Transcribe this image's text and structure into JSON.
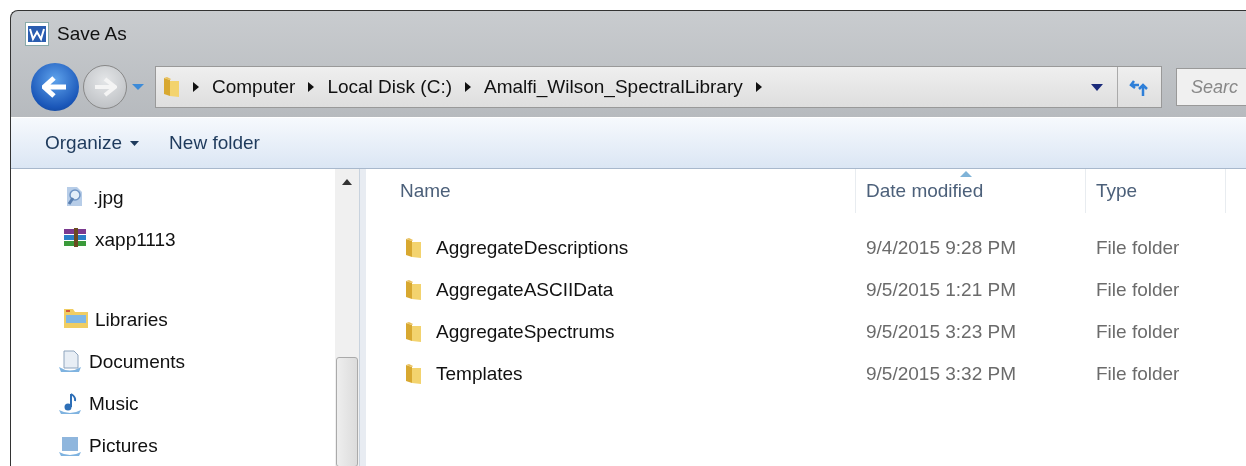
{
  "window": {
    "title": "Save As"
  },
  "address_bar": {
    "crumbs": [
      "Computer",
      "Local Disk (C:)",
      "Amalfi_Wilson_SpectralLibrary"
    ]
  },
  "search": {
    "placeholder": "Searc"
  },
  "toolbar": {
    "organize": "Organize",
    "new_folder": "New folder"
  },
  "sidebar": {
    "items": [
      {
        "label": ".jpg",
        "kind": "image"
      },
      {
        "label": "xapp1113",
        "kind": "archive"
      },
      {
        "label": "Libraries",
        "kind": "library",
        "children": [
          {
            "label": "Documents",
            "kind": "documents"
          },
          {
            "label": "Music",
            "kind": "music"
          },
          {
            "label": "Pictures",
            "kind": "pictures"
          }
        ]
      }
    ]
  },
  "table": {
    "columns": [
      {
        "label": "Name",
        "sorted": false
      },
      {
        "label": "Date modified",
        "sorted": true
      },
      {
        "label": "Type",
        "sorted": false
      }
    ],
    "rows": [
      {
        "name": "AggregateDescriptions",
        "date": "9/4/2015 9:28 PM",
        "type": "File folder"
      },
      {
        "name": "AggregateASCIIData",
        "date": "9/5/2015 1:21 PM",
        "type": "File folder"
      },
      {
        "name": "AggregateSpectrums",
        "date": "9/5/2015 3:23 PM",
        "type": "File folder"
      },
      {
        "name": "Templates",
        "date": "9/5/2015 3:32 PM",
        "type": "File folder"
      }
    ]
  }
}
